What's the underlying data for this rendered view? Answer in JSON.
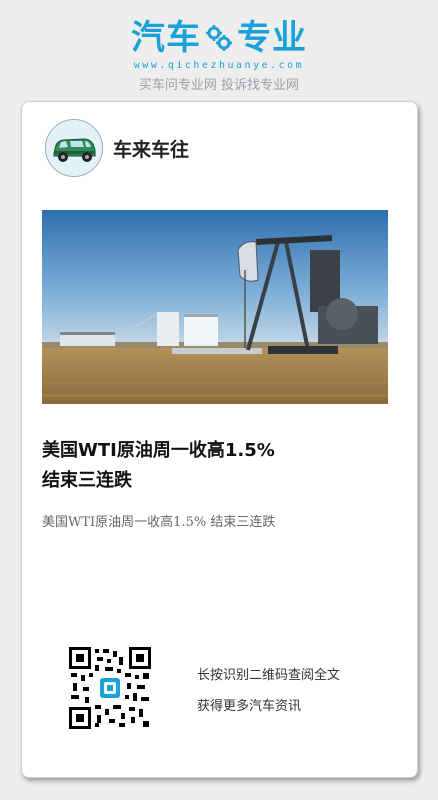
{
  "brand": {
    "name_left": "汽车",
    "name_right": "专业",
    "url": "www.qichezhuanye.com",
    "slogan": "买车问专业网 投诉找专业网",
    "accent_color": "#1aa2d8"
  },
  "card": {
    "author": "车来车往",
    "avatar_icon": "green-car-icon",
    "image_description_icon": "oil-pumpjack-photo",
    "title_line1": "美国WTI原油周一收高1.5%",
    "title_line2": "结束三连跌",
    "summary": "美国WTI原油周一收高1.5% 结束三连跌",
    "qr_icon": "qr-code-icon",
    "hint_line1": "长按识别二维码查阅全文",
    "hint_line2": "获得更多汽车资讯"
  }
}
